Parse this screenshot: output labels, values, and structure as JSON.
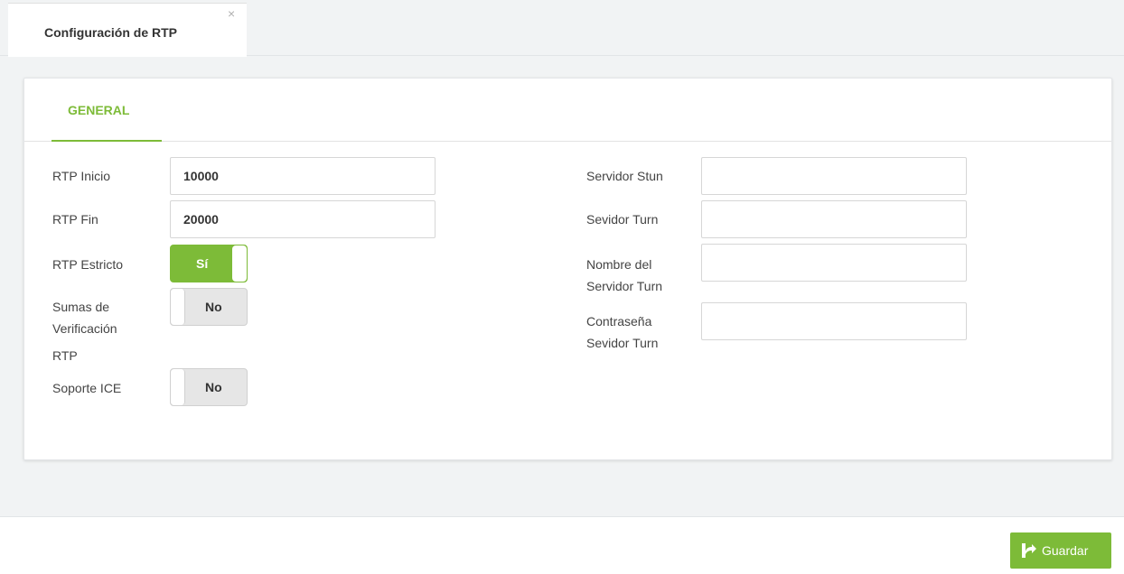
{
  "tab": {
    "label": "Configuración de RTP",
    "close": "×"
  },
  "section_tab": {
    "label": "GENERAL"
  },
  "left": {
    "rtp_start": {
      "label": "RTP Inicio",
      "value": "10000"
    },
    "rtp_end": {
      "label": "RTP Fin",
      "value": "20000"
    },
    "rtp_strict": {
      "label": "RTP Estricto",
      "state": "Sí"
    },
    "rtp_checksums": {
      "label_line1": "Sumas de",
      "label_line2": "Verificación",
      "label_line3": "RTP",
      "state": "No"
    },
    "ice_support": {
      "label": "Soporte ICE",
      "state": "No"
    }
  },
  "right": {
    "stun_server": {
      "label": "Servidor Stun",
      "value": ""
    },
    "turn_server": {
      "label": "Sevidor Turn",
      "value": ""
    },
    "turn_user": {
      "label_line1": "Nombre del",
      "label_line2": "Servidor Turn",
      "value": ""
    },
    "turn_password": {
      "label_line1": "Contraseña",
      "label_line2": "Sevidor Turn",
      "value": ""
    }
  },
  "footer": {
    "save_label": "Guardar",
    "save_icon": "share-save-icon"
  },
  "colors": {
    "accent": "#7dbb38",
    "background": "#f1f3f4"
  }
}
